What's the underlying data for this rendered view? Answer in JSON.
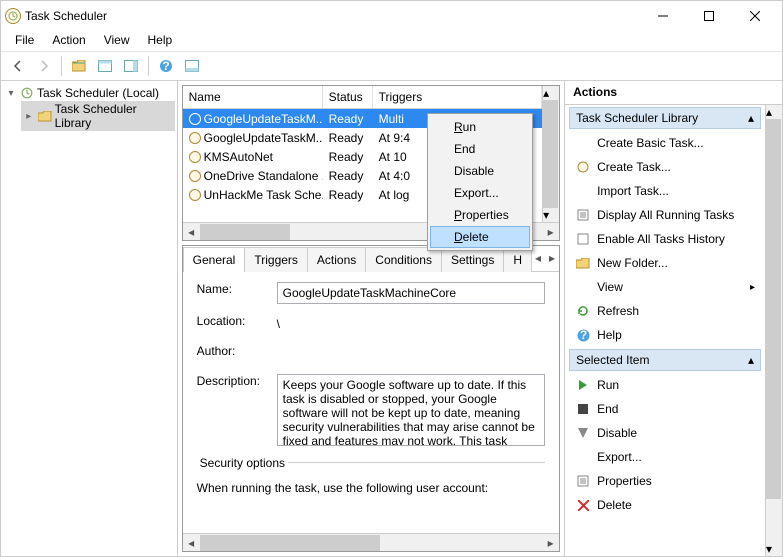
{
  "window": {
    "title": "Task Scheduler"
  },
  "menu": {
    "file": "File",
    "action": "Action",
    "view": "View",
    "help": "Help"
  },
  "tree": {
    "root": "Task Scheduler (Local)",
    "library": "Task Scheduler Library"
  },
  "tasklist": {
    "headers": {
      "name": "Name",
      "status": "Status",
      "triggers": "Triggers"
    },
    "rows": [
      {
        "name": "GoogleUpdateTaskM...",
        "status": "Ready",
        "triggers": "Multi"
      },
      {
        "name": "GoogleUpdateTaskM...",
        "status": "Ready",
        "triggers": "At 9:4"
      },
      {
        "name": "KMSAutoNet",
        "status": "Ready",
        "triggers": "At 10"
      },
      {
        "name": "OneDrive Standalone ...",
        "status": "Ready",
        "triggers": "At 4:0"
      },
      {
        "name": "UnHackMe Task Sche...",
        "status": "Ready",
        "triggers": "At log"
      }
    ]
  },
  "detail": {
    "tabs": {
      "general": "General",
      "triggers": "Triggers",
      "actions": "Actions",
      "conditions": "Conditions",
      "settings": "Settings",
      "history": "H"
    },
    "name_label": "Name:",
    "name_value": "GoogleUpdateTaskMachineCore",
    "location_label": "Location:",
    "location_value": "\\",
    "author_label": "Author:",
    "description_label": "Description:",
    "description_value": "Keeps your Google software up to date. If this task is disabled or stopped, your Google software will not be kept up to date, meaning security vulnerabilities that may arise cannot be fixed and features may not work. This task uninstalls",
    "security_title": "Security options",
    "security_text": "When running the task, use the following user account:"
  },
  "context_menu": {
    "run": "Run",
    "end": "End",
    "disable": "Disable",
    "export": "Export...",
    "properties": "Properties",
    "delete": "Delete"
  },
  "actions": {
    "title": "Actions",
    "section1_title": "Task Scheduler Library",
    "create_basic": "Create Basic Task...",
    "create_task": "Create Task...",
    "import_task": "Import Task...",
    "display_all": "Display All Running Tasks",
    "enable_history": "Enable All Tasks History",
    "new_folder": "New Folder...",
    "view": "View",
    "refresh": "Refresh",
    "help": "Help",
    "section2_title": "Selected Item",
    "run": "Run",
    "end": "End",
    "disable": "Disable",
    "export": "Export...",
    "properties": "Properties",
    "delete": "Delete"
  }
}
